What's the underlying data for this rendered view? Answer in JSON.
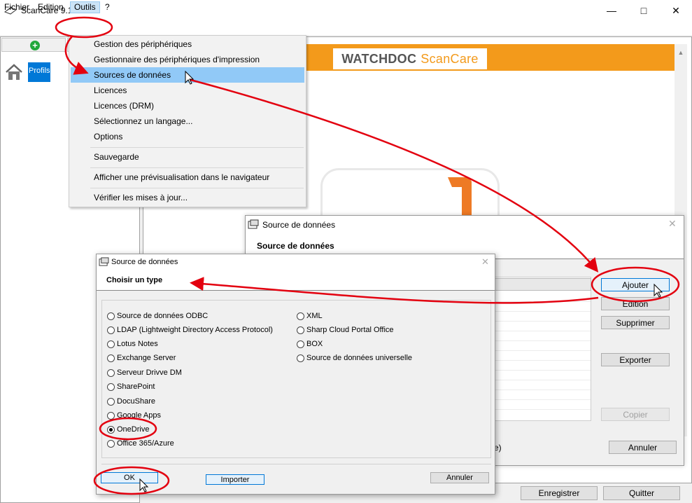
{
  "window": {
    "title": "ScanCare 9.10.525"
  },
  "menubar": {
    "items": [
      "Fichier",
      "Edition",
      "Outils",
      "?"
    ]
  },
  "left_panel": {
    "profile_label": "Profils"
  },
  "banner": {
    "logo_text": "WATCHDOC",
    "logo_accent": "ScanCare",
    "color": "#f39a1b"
  },
  "dropdown": {
    "items": [
      "Gestion des périphériques",
      "Gestionnaire des périphériques d'impression",
      "Sources de données",
      "Licences",
      "Licences (DRM)",
      "Sélectionnez un langage...",
      "Options",
      "Sauvegarde",
      "Afficher une prévisualisation dans le navigateur",
      "Vérifier les mises à jour..."
    ],
    "highlighted_index": 2
  },
  "dialog_datasource": {
    "title": "Source de données",
    "heading": "Source de données",
    "buttons": {
      "add": "Ajouter",
      "edit": "Edition",
      "delete": "Supprimer",
      "export": "Exporter",
      "copy": "Copier",
      "cancel": "Annuler"
    },
    "partial_text": "e)"
  },
  "dialog_type": {
    "title": "Source de données",
    "heading": "Choisir un type",
    "options_left": [
      "Source de données ODBC",
      "LDAP (Lightweight Directory Access Protocol)",
      "Lotus Notes",
      "Exchange Server",
      "Serveur Drivve DM",
      "SharePoint",
      "DocuShare",
      "Google Apps",
      "OneDrive",
      "Office 365/Azure"
    ],
    "options_right": [
      "XML",
      "Sharp Cloud Portal Office",
      "BOX",
      "Source de données universelle"
    ],
    "selected": "OneDrive",
    "buttons": {
      "ok": "OK",
      "import": "Importer",
      "cancel": "Annuler"
    }
  },
  "bottom_bar": {
    "save": "Enregistrer",
    "quit": "Quitter"
  },
  "annotation_color": "#e3000f"
}
